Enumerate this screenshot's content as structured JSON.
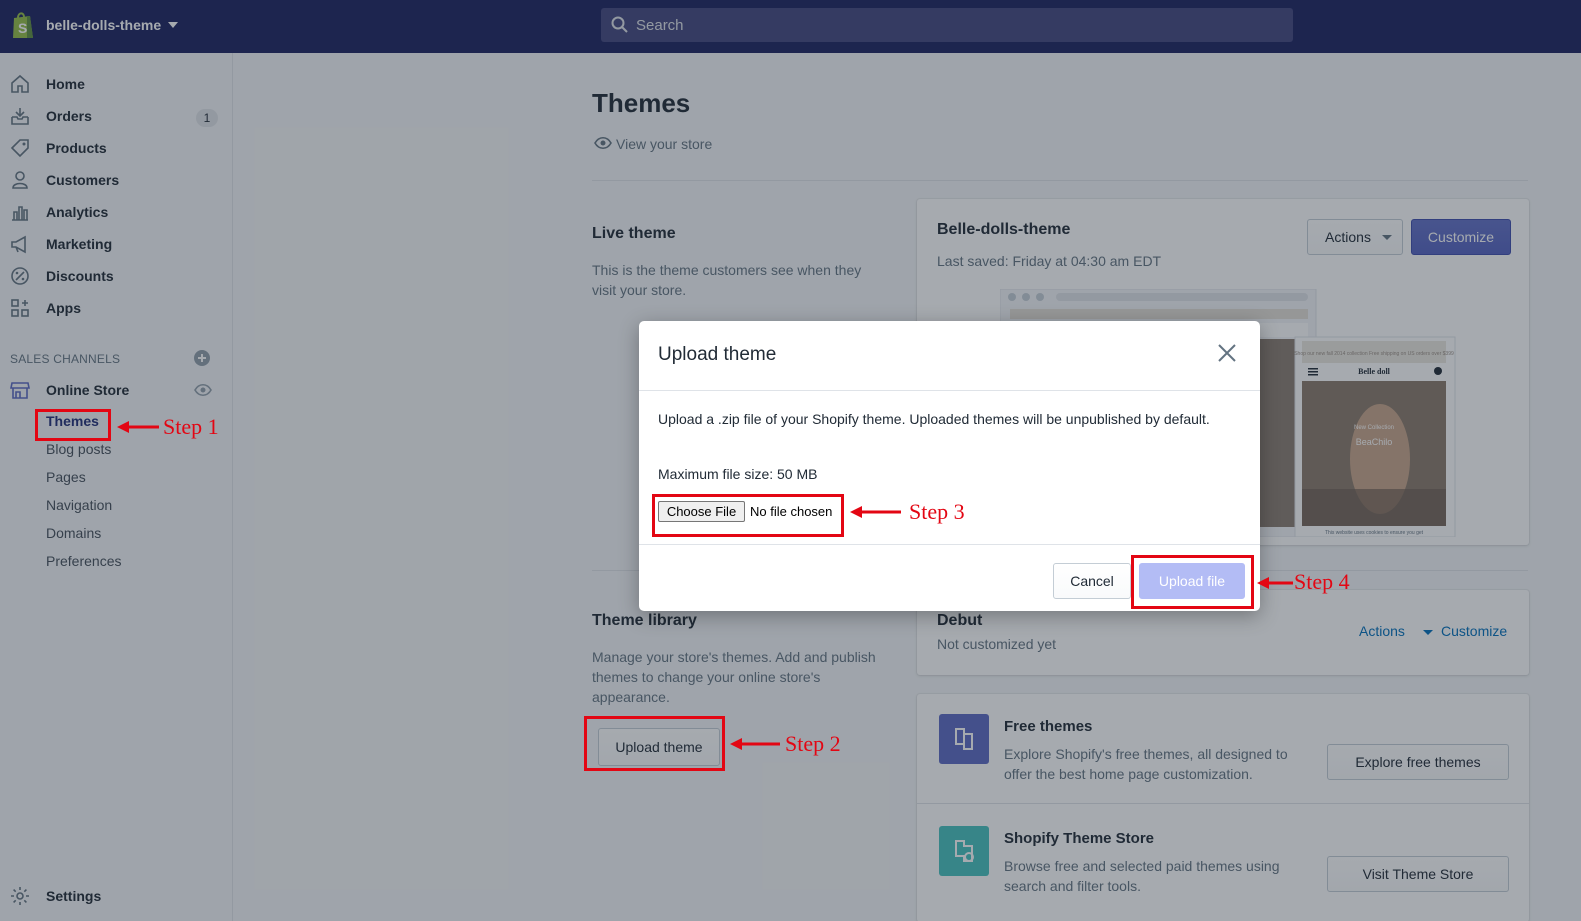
{
  "topbar": {
    "store_name": "belle-dolls-theme",
    "search_placeholder": "Search",
    "logo_icon": "shopify-bag-icon",
    "caret_icon": "chevron-down-icon"
  },
  "sidebar": {
    "items": [
      {
        "label": "Home",
        "icon": "home-icon"
      },
      {
        "label": "Orders",
        "icon": "orders-icon",
        "badge": "1"
      },
      {
        "label": "Products",
        "icon": "tag-icon"
      },
      {
        "label": "Customers",
        "icon": "person-icon"
      },
      {
        "label": "Analytics",
        "icon": "bar-chart-icon"
      },
      {
        "label": "Marketing",
        "icon": "megaphone-icon"
      },
      {
        "label": "Discounts",
        "icon": "discount-icon"
      },
      {
        "label": "Apps",
        "icon": "apps-icon"
      }
    ],
    "sales_channels_heading": "SALES CHANNELS",
    "online_store": "Online Store",
    "sub_items": [
      "Themes",
      "Blog posts",
      "Pages",
      "Navigation",
      "Domains",
      "Preferences"
    ],
    "settings": "Settings"
  },
  "main": {
    "title": "Themes",
    "view_store": "View your store",
    "live_theme": {
      "heading": "Live theme",
      "description": "This is the theme customers see when they visit your store.",
      "theme_name": "Belle-dolls-theme",
      "last_saved": "Last saved: Friday at 04:30 am EDT",
      "actions_label": "Actions",
      "customize_label": "Customize",
      "preview": {
        "mobile_banner": "Shop our new fall 2014 collection Free shipping on US orders over $399",
        "brand": "Belle doll",
        "collection": "New Collection",
        "model_name": "BeaChilo",
        "cookie": "This website uses cookies to ensure you get"
      }
    },
    "theme_library": {
      "heading": "Theme library",
      "description": "Manage your store's themes. Add and publish themes to change your online store's appearance.",
      "upload_label": "Upload theme",
      "debut_name": "Debut",
      "debut_status": "Not customized yet",
      "debut_actions": "Actions",
      "debut_customize": "Customize"
    },
    "free_themes": {
      "title": "Free themes",
      "description": "Explore Shopify's free themes, all designed to offer the best home page customization.",
      "button": "Explore free themes"
    },
    "theme_store": {
      "title": "Shopify Theme Store",
      "description": "Browse free and selected paid themes using search and filter tools.",
      "button": "Visit Theme Store"
    }
  },
  "modal": {
    "title": "Upload theme",
    "description": "Upload a .zip file of your Shopify theme. Uploaded themes will be unpublished by default.",
    "max_size": "Maximum file size: 50 MB",
    "choose_file": "Choose File",
    "no_file": "No file chosen",
    "cancel": "Cancel",
    "upload": "Upload file"
  },
  "annotations": {
    "step1": "Step 1",
    "step2": "Step 2",
    "step3": "Step 3",
    "step4": "Step 4",
    "color": "#e30613"
  },
  "colors": {
    "topbar": "#1c2260",
    "primary": "#5c6ac4",
    "link": "#006fbb"
  }
}
